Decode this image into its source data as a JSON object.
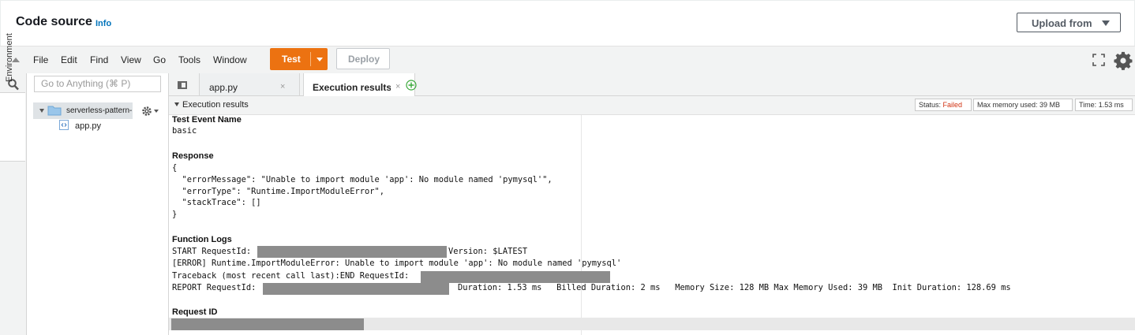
{
  "header": {
    "title": "Code source",
    "info": "Info",
    "upload_label": "Upload from"
  },
  "menubar": {
    "items": [
      "File",
      "Edit",
      "Find",
      "View",
      "Go",
      "Tools",
      "Window"
    ],
    "test_label": "Test",
    "deploy_label": "Deploy"
  },
  "sidebar": {
    "env_label": "Environment",
    "search_placeholder": "Go to Anything (⌘ P)",
    "folder": "serverless-pattern-l",
    "file": "app.py"
  },
  "tabs": [
    {
      "label": "app.py",
      "close": "×"
    },
    {
      "label": "Execution results",
      "close": "×"
    }
  ],
  "results": {
    "title": "Execution results",
    "status_label": "Status:",
    "status_value": "Failed",
    "memory_label": "Max memory used:",
    "memory_value": "39 MB",
    "time_label": "Time:",
    "time_value": "1.53 ms"
  },
  "output": {
    "event_title": "Test Event Name",
    "event_name": "basic",
    "response_title": "Response",
    "response_lines": [
      "{",
      "  \"errorMessage\": \"Unable to import module 'app': No module named 'pymysql'\",",
      "  \"errorType\": \"Runtime.ImportModuleError\",",
      "  \"stackTrace\": []",
      "}"
    ],
    "logs_title": "Function Logs",
    "log_start_prefix": "START RequestId:",
    "log_start_suffix": "Version: $LATEST",
    "log_error": "[ERROR] Runtime.ImportModuleError: Unable to import module 'app': No module named 'pymysql'",
    "log_traceback": "Traceback (most recent call last):END RequestId:",
    "log_report_prefix": "REPORT RequestId:",
    "log_report_suffix": "Duration: 1.53 ms   Billed Duration: 2 ms   Memory Size: 128 MB Max Memory Used: 39 MB  Init Duration: 128.69 ms",
    "request_id_title": "Request ID"
  },
  "colors": {
    "accent": "#ec7211",
    "link": "#0073bb",
    "failed": "#d13212"
  }
}
